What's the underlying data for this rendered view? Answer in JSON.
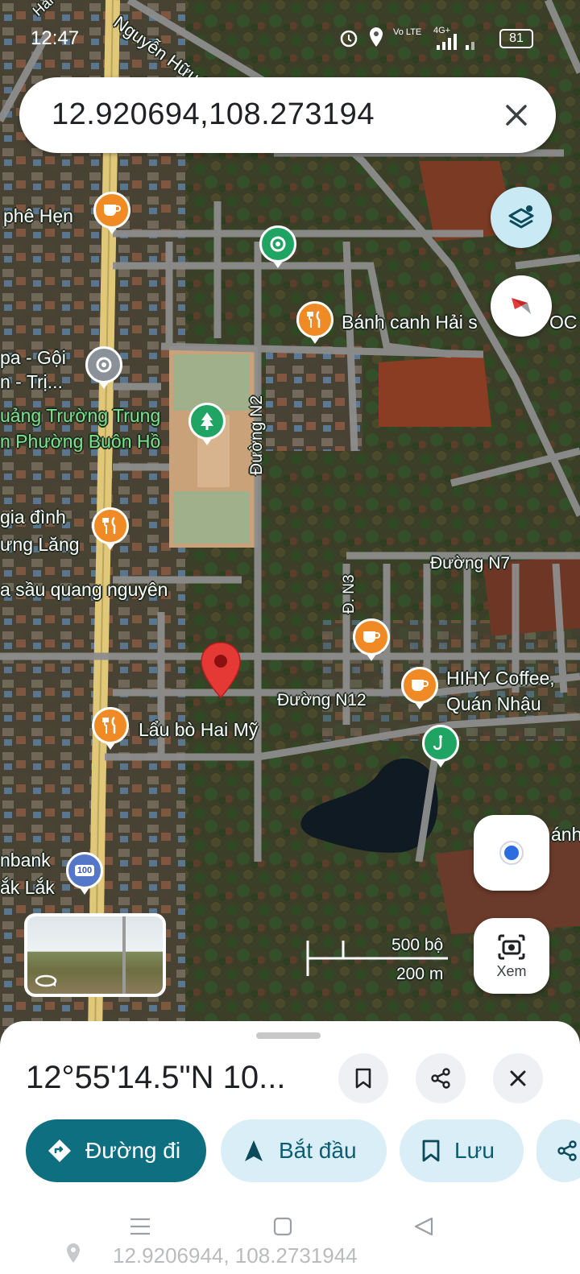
{
  "status": {
    "time": "12:47",
    "carrier": "Vo LTE",
    "network": "4G+",
    "battery": "81"
  },
  "search": {
    "query": "12.920694,108.273194"
  },
  "map": {
    "labels": {
      "nguyen_huu_tien": "Nguyễn Hữu Tiế",
      "hai_truong": "Hải Trư",
      "ca_phe_hen": "phê Hẹn",
      "banh_canh": "Bánh canh Hải s",
      "banh_canh_suffix": "OC",
      "spa_line1": "pa - Gội",
      "spa_line2": "n - Trị...",
      "quang_truong_line1": "uảng Trường Trung",
      "quang_truong_line2": "n Phường Buôn Hồ",
      "duong_n2": "Đường N2",
      "gia_dinh_line1": "gia đình",
      "gia_dinh_line2": "ưng Lăng",
      "sau_quang": "a sầu quang nguyên",
      "duong_n7": "Đường N7",
      "d_n3": "Đ. N3",
      "hihy_line1": "HIHY Coffee,",
      "hihy_line2": "Quán Nhậu",
      "duong_n12": "Đường N12",
      "lau_bo": "Lẩu bò Hai Mỹ",
      "bank_line1": "nbank",
      "bank_line2": "ắk Lắk",
      "bank_badge": "100",
      "right_edge": "ánh"
    },
    "scale": {
      "imperial": "500 bộ",
      "metric": "200 m"
    },
    "lens_label": "Xem"
  },
  "sheet": {
    "title": "12°55'14.5\"N 10...",
    "actions": {
      "directions": "Đường đi",
      "start": "Bắt đầu",
      "save": "Lưu"
    }
  },
  "footer": {
    "coords": "12.9206944, 108.2731944"
  },
  "colors": {
    "primary": "#0e6f80",
    "chip": "#d9eef6",
    "pin_red": "#e53935",
    "poi_orange": "#f08a24",
    "poi_green": "#1fa463"
  }
}
